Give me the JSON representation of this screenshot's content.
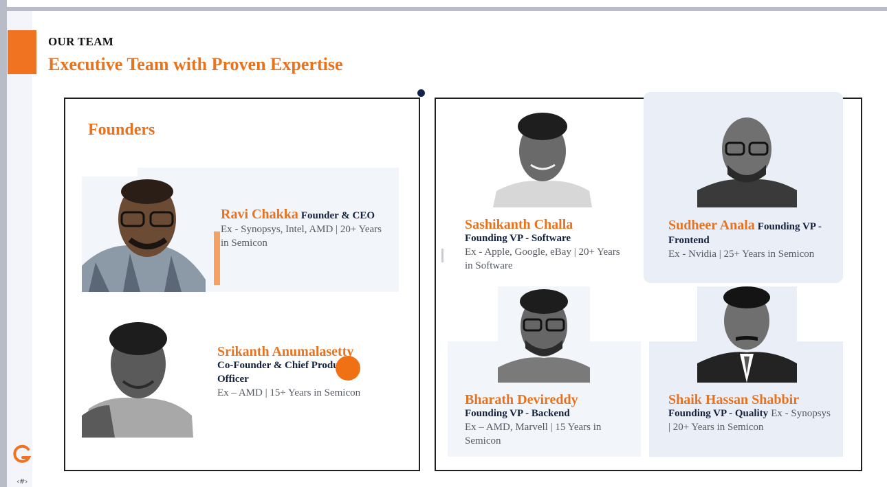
{
  "header": {
    "eyebrow": "OUR TEAM",
    "title": "Executive Team with Proven Expertise"
  },
  "founders": {
    "heading": "Founders",
    "people": [
      {
        "name": "Ravi Chakka",
        "role": "Founder & CEO",
        "info": "Ex -  Synopsys, Intel, AMD | 20+ Years in Semicon"
      },
      {
        "name": "Srikanth Anumalasetty",
        "role": "Co-Founder & Chief Product Officer",
        "info": "Ex – AMD | 15+ Years in Semicon"
      }
    ]
  },
  "vps": [
    {
      "name": "Sashikanth Challa",
      "role": "Founding VP - Software",
      "info": "Ex - Apple, Google, eBay | 20+ Years in Software"
    },
    {
      "name": "Sudheer Anala",
      "role": "Founding VP - Frontend",
      "info": "Ex - Nvidia | 25+ Years in Semicon"
    },
    {
      "name": "Bharath Devireddy",
      "role": "Founding VP - Backend",
      "info": "Ex – AMD, Marvell | 15 Years in Semicon"
    },
    {
      "name": "Shaik Hassan Shabbir",
      "role": "Founding VP - Quality",
      "info": "Ex - Synopsys | 20+ Years in Semicon"
    }
  ],
  "footer": {
    "page_number": "‹#›"
  },
  "colors": {
    "accent": "#e8731f",
    "navy": "#13213f",
    "panel_tint": "#f2f5fa"
  },
  "icons": {
    "logo": "company-logo-icon"
  }
}
